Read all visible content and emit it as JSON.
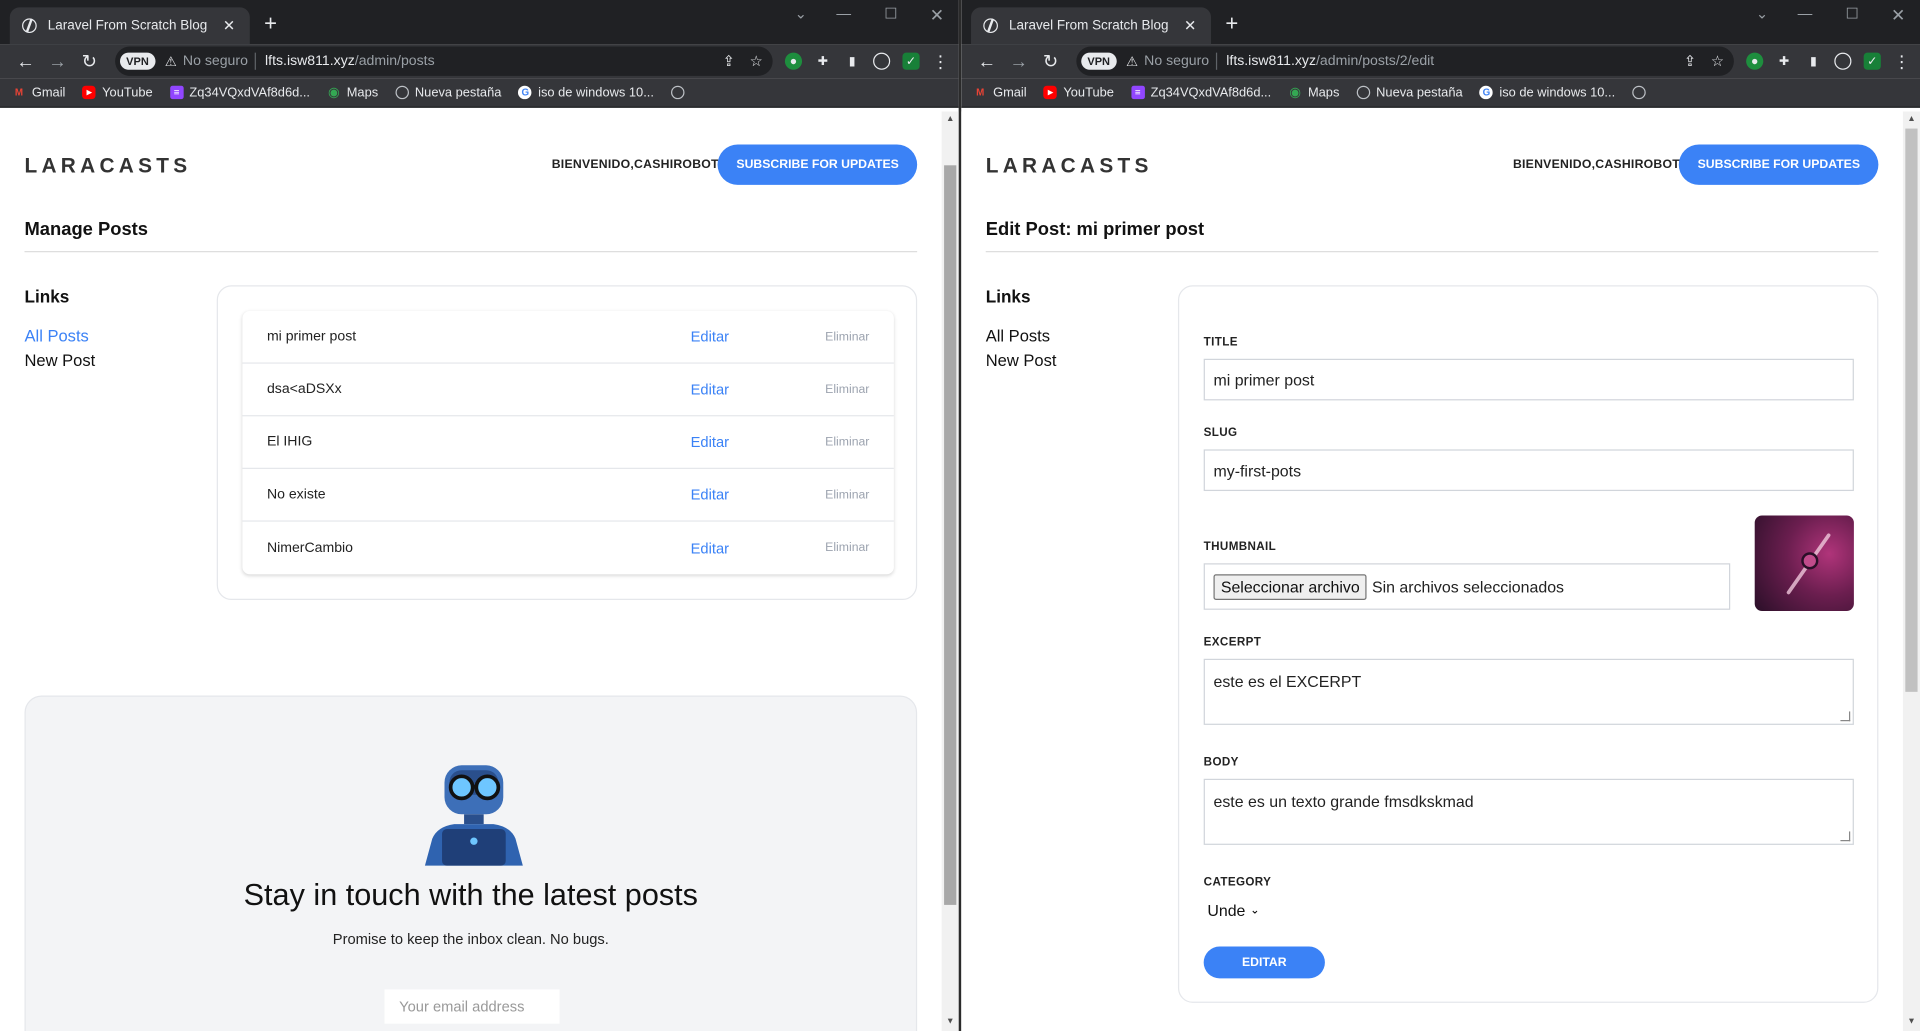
{
  "left": {
    "tab_title": "Laravel From Scratch Blog",
    "vpn": "VPN",
    "not_secure": "No seguro",
    "url_host": "lfts.isw811.xyz",
    "url_path": "/admin/posts",
    "bookmarks": [
      "Gmail",
      "YouTube",
      "Zq34VQxdVAf8d6d...",
      "Maps",
      "Nueva pestaña",
      "iso de windows 10..."
    ],
    "logo": "LARACASTS",
    "welcome": "BIENVENIDO,CASHIROBOT",
    "subscribe": "SUBSCRIBE FOR UPDATES",
    "page_title": "Manage Posts",
    "links_heading": "Links",
    "links": [
      "All Posts",
      "New Post"
    ],
    "posts": [
      {
        "title": "mi primer post",
        "edit": "Editar",
        "delete": "Eliminar"
      },
      {
        "title": "dsa<aDSXx",
        "edit": "Editar",
        "delete": "Eliminar"
      },
      {
        "title": "El IHIG",
        "edit": "Editar",
        "delete": "Eliminar"
      },
      {
        "title": "No existe",
        "edit": "Editar",
        "delete": "Eliminar"
      },
      {
        "title": "NimerCambio",
        "edit": "Editar",
        "delete": "Eliminar"
      }
    ],
    "newsletter": {
      "title": "Stay in touch with the latest posts",
      "subtitle": "Promise to keep the inbox clean. No bugs.",
      "email_placeholder": "Your email address"
    }
  },
  "right": {
    "tab_title": "Laravel From Scratch Blog",
    "vpn": "VPN",
    "not_secure": "No seguro",
    "url_host": "lfts.isw811.xyz",
    "url_path": "/admin/posts/2/edit",
    "bookmarks": [
      "Gmail",
      "YouTube",
      "Zq34VQxdVAf8d6d...",
      "Maps",
      "Nueva pestaña",
      "iso de windows 10..."
    ],
    "logo": "LARACASTS",
    "welcome": "BIENVENIDO,CASHIROBOT",
    "subscribe": "SUBSCRIBE FOR UPDATES",
    "page_title": "Edit Post: mi primer post",
    "links_heading": "Links",
    "links": [
      "All Posts",
      "New Post"
    ],
    "form": {
      "title_label": "TITLE",
      "title_value": "mi primer post",
      "slug_label": "SLUG",
      "slug_value": "my-first-pots",
      "thumbnail_label": "THUMBNAIL",
      "file_button": "Seleccionar archivo",
      "file_status": "Sin archivos seleccionados",
      "excerpt_label": "EXCERPT",
      "excerpt_value": "este es el EXCERPT",
      "body_label": "BODY",
      "body_value": "este es un texto grande fmsdkskmad",
      "category_label": "CATEGORY",
      "category_value": "Unde",
      "submit": "EDITAR"
    }
  },
  "colors": {
    "accent": "#3b82f6",
    "chrome_dark": "#202124",
    "chrome_toolbar": "#35363a"
  }
}
